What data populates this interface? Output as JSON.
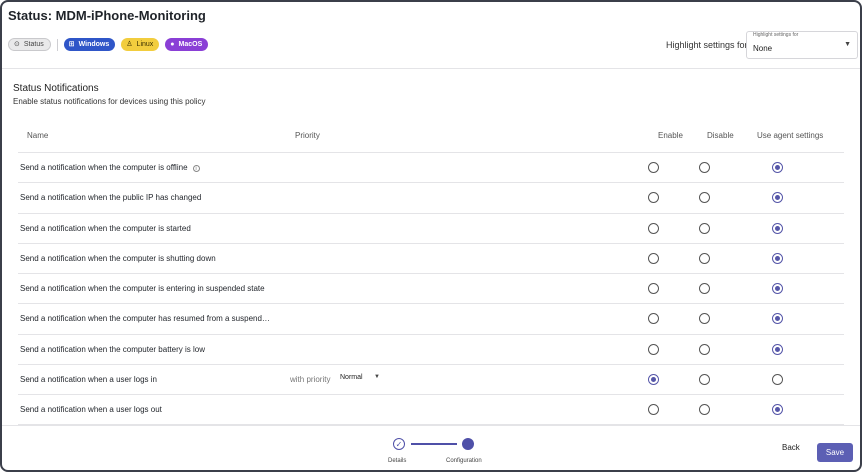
{
  "page": {
    "title": "Status: MDM-iPhone-Monitoring"
  },
  "tags": {
    "status": "Status",
    "windows": "Windows",
    "linux": "Linux",
    "macos": "MacOS"
  },
  "highlight": {
    "label": "Highlight settings for",
    "float_label": "Highlight settings for",
    "value": "None"
  },
  "section": {
    "title": "Status Notifications",
    "subtitle": "Enable status notifications for devices using this policy"
  },
  "table": {
    "headers": {
      "name": "Name",
      "priority": "Priority",
      "enable": "Enable",
      "disable": "Disable",
      "agent": "Use agent settings"
    },
    "rows": [
      {
        "label": "Send a notification when the computer is offline",
        "selected": "agent",
        "info": true
      },
      {
        "label": "Send a notification when the public IP has changed",
        "selected": "agent"
      },
      {
        "label": "Send a notification when the computer is started",
        "selected": "agent"
      },
      {
        "label": "Send a notification when the computer is shutting down",
        "selected": "agent"
      },
      {
        "label": "Send a notification when the computer is entering in suspended state",
        "selected": "agent"
      },
      {
        "label": "Send a notification when the computer has resumed from a suspend…",
        "selected": "agent"
      },
      {
        "label": "Send a notification when the computer battery is low",
        "selected": "agent"
      },
      {
        "label": "Send a notification when a user logs in",
        "selected": "enable",
        "priority_label": "with priority",
        "priority_value": "Normal"
      },
      {
        "label": "Send a notification when a user logs out",
        "selected": "agent"
      }
    ]
  },
  "footer": {
    "steps": [
      "Details",
      "Configuration"
    ],
    "back_label": "Back",
    "save_label": "Save"
  },
  "colors": {
    "accent": "#5556a8",
    "windows": "#2f56c8",
    "linux": "#f2cd3e",
    "macos": "#8a3fd6"
  }
}
